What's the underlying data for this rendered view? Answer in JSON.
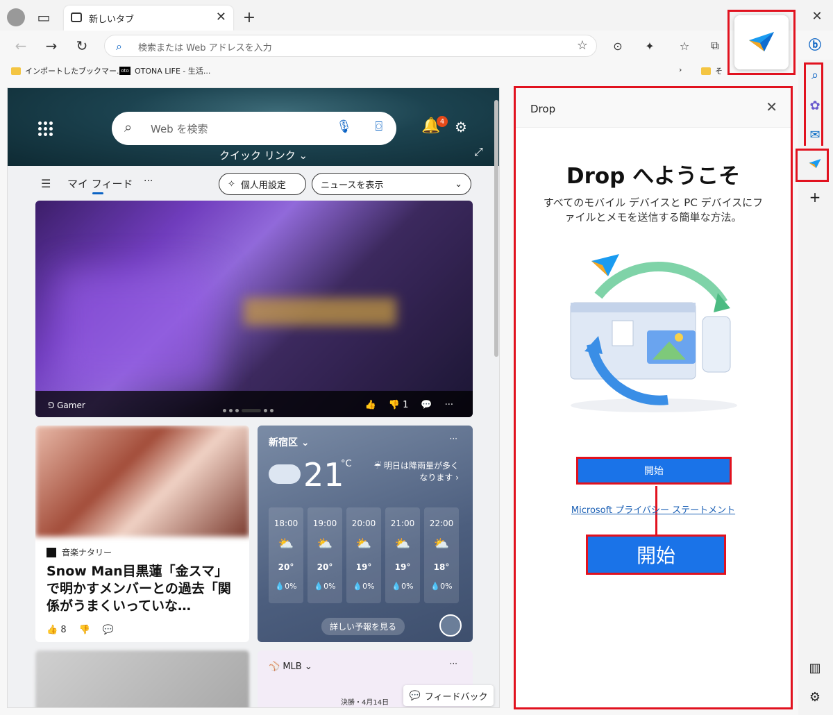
{
  "browser": {
    "tab_title": "新しいタブ",
    "address_placeholder": "検索または Web アドレスを入力",
    "favorites": [
      {
        "label": "インポートしたブックマー..."
      },
      {
        "label": "OTONA LIFE - 生活..."
      },
      {
        "label": "そ"
      }
    ]
  },
  "hero": {
    "search_placeholder": "Web を検索",
    "quick_links": "クイック リンク",
    "notification_count": "4"
  },
  "feed_nav": {
    "my_feed": "マイ フィード",
    "personalize": "個人用設定",
    "show_news": "ニュースを表示"
  },
  "big_card": {
    "source": "Gamer",
    "reactions": "1"
  },
  "news_card": {
    "source": "音楽ナタリー",
    "headline": "Snow Man目黒蓮「金スマ」で明かすメンバーとの過去「関係がうまくいっていな…",
    "likes": "8"
  },
  "weather": {
    "location": "新宿区",
    "temperature": "21",
    "unit": "°C",
    "forecast": "明日は降雨量が多くなります",
    "hours": [
      {
        "time": "18:00",
        "temp": "20°",
        "precip": "0%"
      },
      {
        "time": "19:00",
        "temp": "20°",
        "precip": "0%"
      },
      {
        "time": "20:00",
        "temp": "19°",
        "precip": "0%"
      },
      {
        "time": "21:00",
        "temp": "19°",
        "precip": "0%"
      },
      {
        "time": "22:00",
        "temp": "18°",
        "precip": "0%"
      }
    ],
    "detail_link": "詳しい予報を見る"
  },
  "mlb_card": {
    "title": "MLB",
    "score_text": "決勝・4月14日"
  },
  "feedback": "フィードバック",
  "drop": {
    "panel_title": "Drop",
    "welcome": "Drop へようこそ",
    "description": "すべてのモバイル デバイスと PC デバイスにファイルとメモを送信する簡単な方法。",
    "start": "開始",
    "privacy": "Microsoft プライバシー ステートメント",
    "start_zoom": "開始"
  },
  "colors": {
    "highlight_red": "#e1121f",
    "accent_blue": "#1a73e8"
  }
}
